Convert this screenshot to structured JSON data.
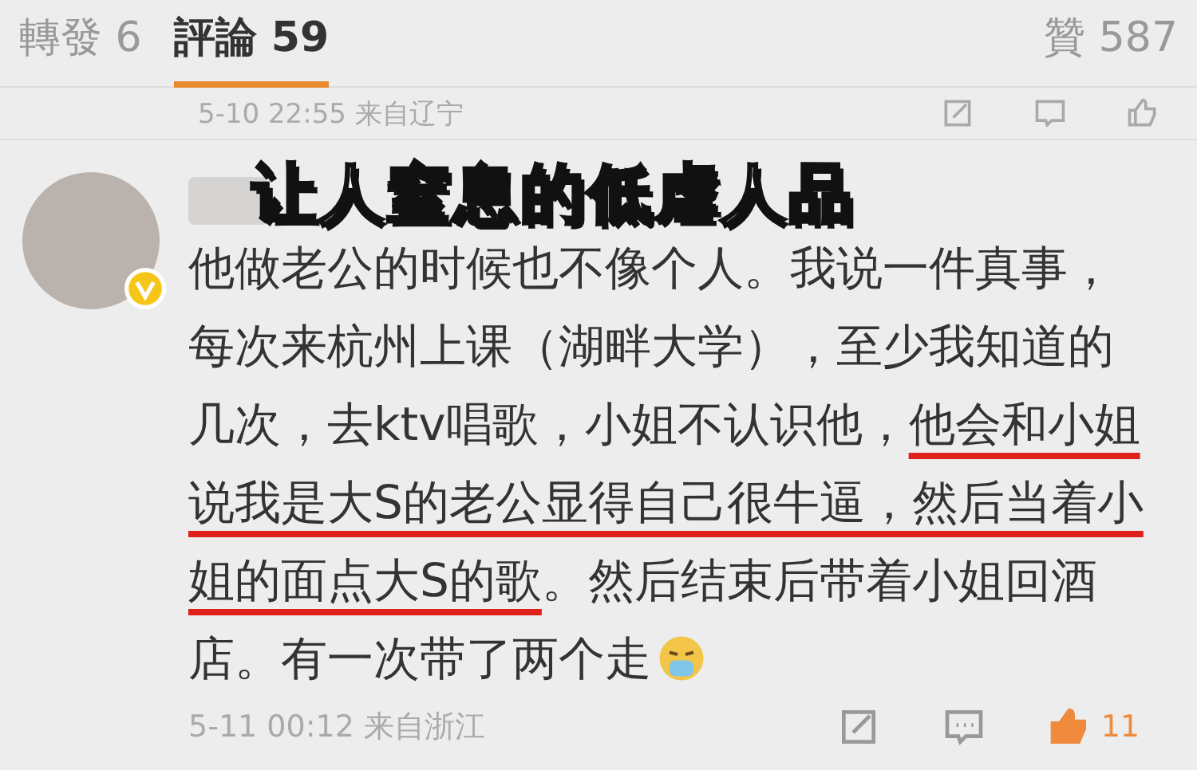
{
  "tabs": [
    {
      "label": "轉發 6",
      "selected": false
    },
    {
      "label": "評論 59",
      "selected": true
    }
  ],
  "likes_tab": {
    "label": "贊 587"
  },
  "previous_comment": {
    "meta": "5-10 22:55 来自辽宁"
  },
  "overlay_caption": "让人窒息的低虐人品",
  "comment": {
    "verified": true,
    "segments": [
      {
        "text": "他做老公的时候也不像个人。我说一件真事，每次来杭州上课（湖畔大学），至少我知道的几次，去ktv唱歌，小姐不认识他，",
        "underlined": false
      },
      {
        "text": "他会和小姐说我是大S的老公显得自己很牛逼，然后当着小姐的面点大S的歌",
        "underlined": true
      },
      {
        "text": "。然后结束后带着小姐回酒店。有一次带了两个走",
        "underlined": false
      }
    ],
    "meta": "5-11 00:12 来自浙江",
    "like_count": "11",
    "liked": true
  }
}
